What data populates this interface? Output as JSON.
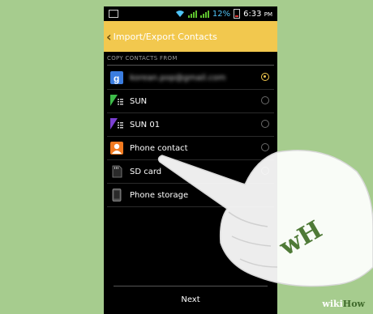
{
  "status": {
    "battery": "12%",
    "time": "6:33",
    "time_suffix": "PM"
  },
  "action_bar": {
    "title": "Import/Export Contacts"
  },
  "section": {
    "header": "COPY CONTACTS FROM"
  },
  "accounts": [
    {
      "label": "korean.pop@gmail.com",
      "icon": "google-icon",
      "selected": true
    },
    {
      "label": "SUN",
      "icon": "sim-icon",
      "selected": false
    },
    {
      "label": "SUN 01",
      "icon": "sim-icon",
      "selected": false
    },
    {
      "label": "Phone contact",
      "icon": "contact-icon",
      "selected": false
    },
    {
      "label": "SD card",
      "icon": "sd-card-icon",
      "selected": false
    },
    {
      "label": "Phone storage",
      "icon": "phone-storage-icon",
      "selected": false
    }
  ],
  "footer": {
    "next_label": "Next"
  },
  "watermark": {
    "wiki": "wiki",
    "how": "How"
  },
  "colors": {
    "accent": "#f2c84e",
    "background": "#a6cc8e",
    "brand": "#3f6a2b"
  }
}
